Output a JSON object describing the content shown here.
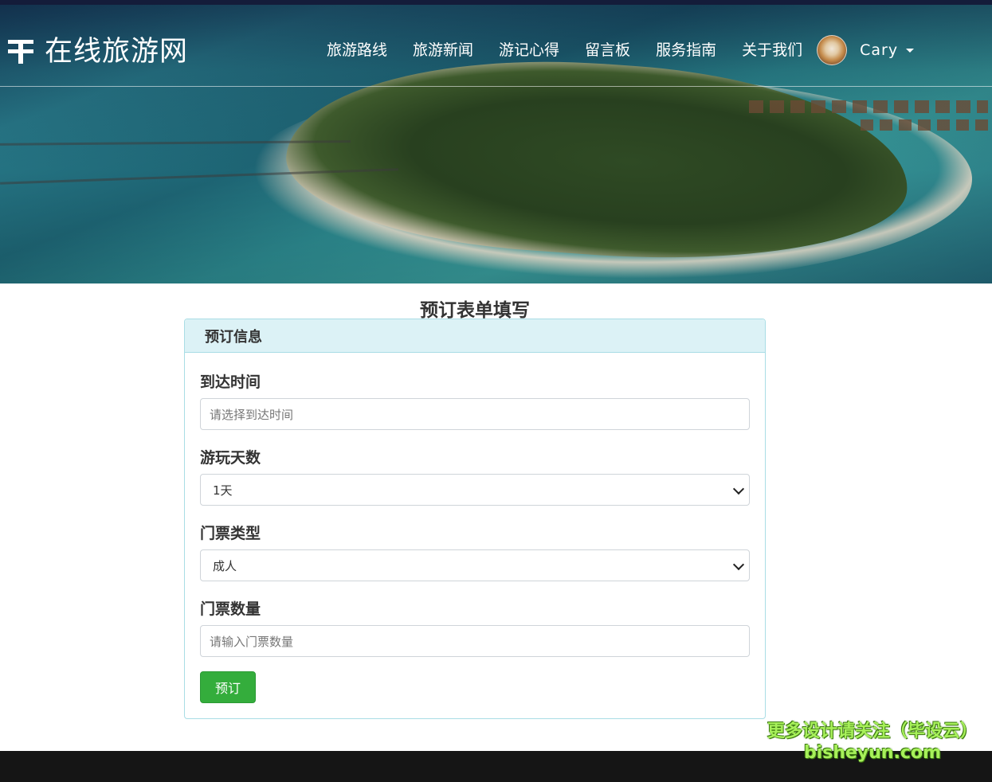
{
  "brand": {
    "title": "在线旅游网"
  },
  "nav": {
    "items": [
      {
        "label": "旅游路线"
      },
      {
        "label": "旅游新闻"
      },
      {
        "label": "游记心得"
      },
      {
        "label": "留言板"
      },
      {
        "label": "服务指南"
      },
      {
        "label": "关于我们"
      }
    ],
    "user": {
      "name": "Cary"
    }
  },
  "page": {
    "title": "预订表单填写"
  },
  "form": {
    "header": "预订信息",
    "arrival": {
      "label": "到达时间",
      "placeholder": "请选择到达时间"
    },
    "days": {
      "label": "游玩天数",
      "selected": "1天"
    },
    "ticket_type": {
      "label": "门票类型",
      "selected": "成人"
    },
    "ticket_count": {
      "label": "门票数量",
      "placeholder": "请输入门票数量"
    },
    "submit_label": "预订"
  },
  "watermark": {
    "line1": "更多设计请关注（毕设云）",
    "line2": "bisheyun.com"
  },
  "colors": {
    "accent": "#34ad3c",
    "card_header_bg": "#dcf2f6",
    "card_border": "#a9dde5",
    "footer": "#151515"
  }
}
